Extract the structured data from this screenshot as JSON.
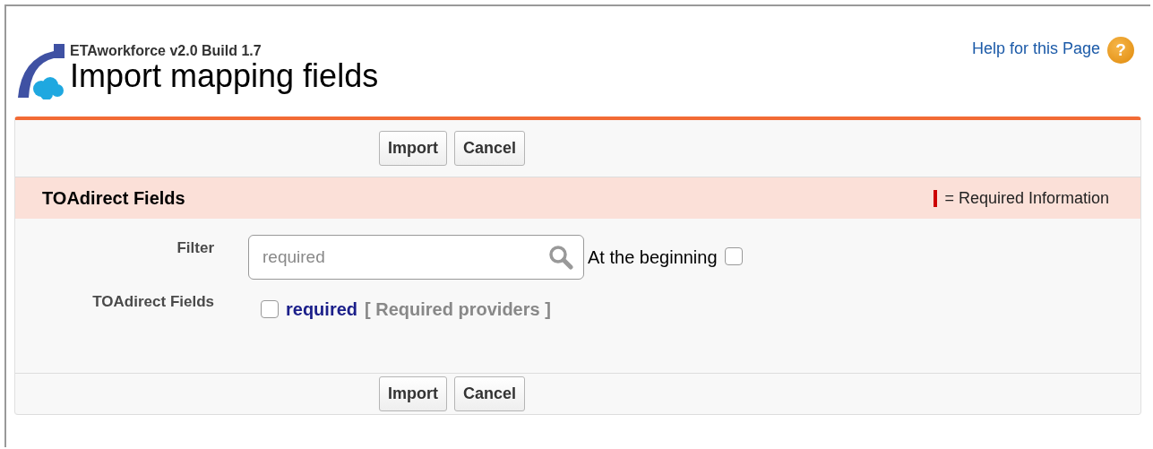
{
  "header": {
    "app_name": "ETAworkforce v2.0 Build 1.7",
    "title": "Import mapping fields",
    "help_link": "Help for this Page",
    "help_icon_text": "?"
  },
  "top_buttons": [
    "Import",
    "Cancel"
  ],
  "section": {
    "title": "TOAdirect Fields",
    "legend": "= Required Information"
  },
  "filter": {
    "label": "Filter",
    "value": "required",
    "option_label": "At the beginning",
    "option_checked": false
  },
  "fields": {
    "label": "TOAdirect Fields",
    "items": [
      {
        "name": "required",
        "description": "[ Required providers ]",
        "checked": false
      }
    ]
  },
  "bottom_buttons": [
    "Import",
    "Cancel"
  ]
}
